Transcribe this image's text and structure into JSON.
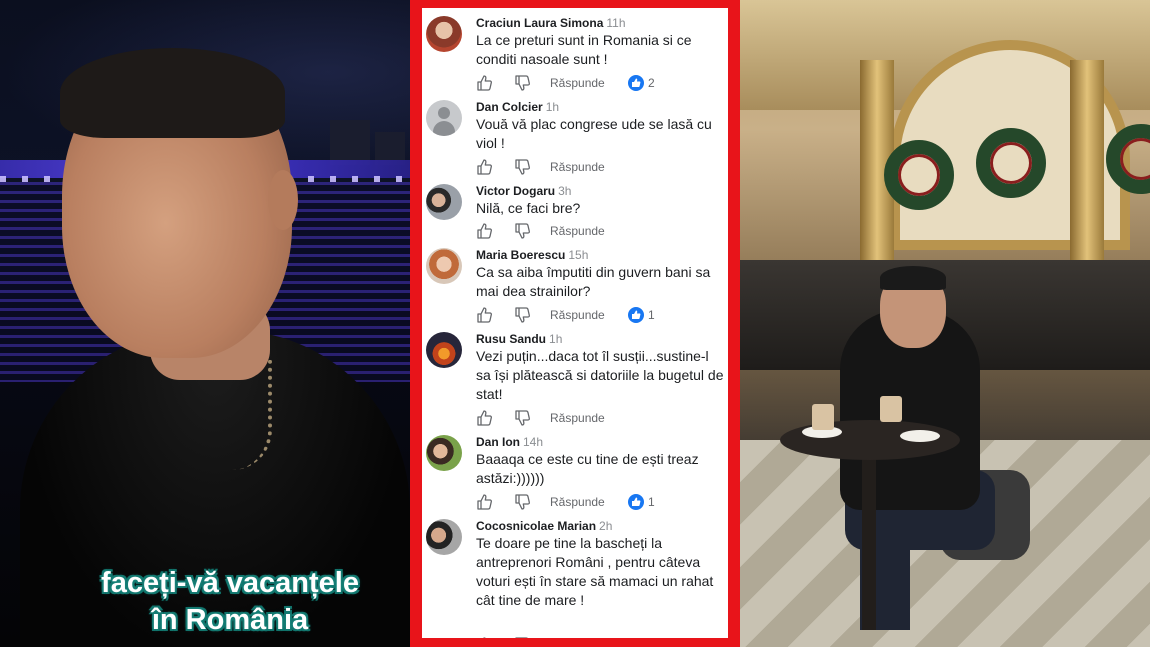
{
  "left_panel": {
    "caption_line1": "faceți-vă vacanțele",
    "caption_line2": "în România"
  },
  "comments": [
    {
      "author": "Craciun Laura Simona",
      "time": "11h",
      "text": "La ce preturi sunt in Romania si ce conditi nasoale sunt !",
      "reply_label": "Răspunde",
      "reactions": "2"
    },
    {
      "author": "Dan Colcier",
      "time": "1h",
      "text": "Vouă vă plac congrese ude se lasă cu viol !",
      "reply_label": "Răspunde",
      "reactions": ""
    },
    {
      "author": "Victor Dogaru",
      "time": "3h",
      "text": "Nilă, ce faci bre?",
      "reply_label": "Răspunde",
      "reactions": ""
    },
    {
      "author": "Maria Boerescu",
      "time": "15h",
      "text": "Ca sa aiba împutiti din guvern bani sa mai dea strainilor?",
      "reply_label": "Răspunde",
      "reactions": "1"
    },
    {
      "author": "Rusu Sandu",
      "time": "1h",
      "text": "Vezi puțin...daca tot îl susții...sustine-l sa își plătească si datoriile la bugetul de stat!",
      "reply_label": "Răspunde",
      "reactions": ""
    },
    {
      "author": "Dan Ion",
      "time": "14h",
      "text": "Baaaqa ce este cu tine de ești treaz astăzi:))))))",
      "reply_label": "Răspunde",
      "reactions": "1"
    },
    {
      "author": "Cocosnicolae Marian",
      "time": "2h",
      "text": "Te doare pe tine la bascheți la antreprenori Români , pentru câteva voturi ești în stare să mamaci un rahat cât tine de mare !",
      "reply_label": "",
      "reactions": ""
    }
  ],
  "colors": {
    "frame_red": "#e8141a",
    "fb_blue": "#1877f2",
    "caption_teal": "#127068"
  }
}
